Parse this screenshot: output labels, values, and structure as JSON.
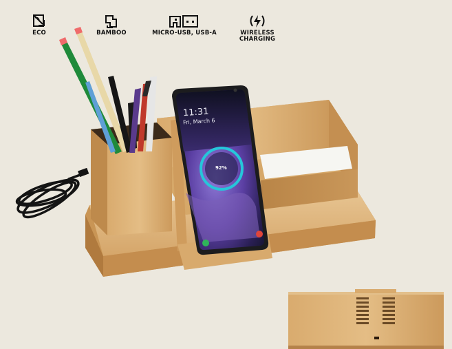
{
  "features": [
    {
      "key": "eco",
      "icon": "eco-icon",
      "label": "ECO"
    },
    {
      "key": "bamboo",
      "icon": "bamboo-icon",
      "label": "BAMBOO"
    },
    {
      "key": "usb",
      "icon": "usb-ports-icon",
      "label": "MICRO-USB, USB-A"
    },
    {
      "key": "wireless",
      "icon": "wireless-charging-icon",
      "label": "WIRELESS\nCHARGING"
    }
  ],
  "phone_screen": {
    "time": "11:31",
    "date": "Fri, March 6",
    "battery": "92%"
  },
  "colors": {
    "background": "#ece8de",
    "bamboo_light": "#dcb27a",
    "bamboo_mid": "#c9975a",
    "bamboo_dark": "#a9763f",
    "phone_frame": "#1c1c1e",
    "charging_ring": "#26c6da"
  }
}
